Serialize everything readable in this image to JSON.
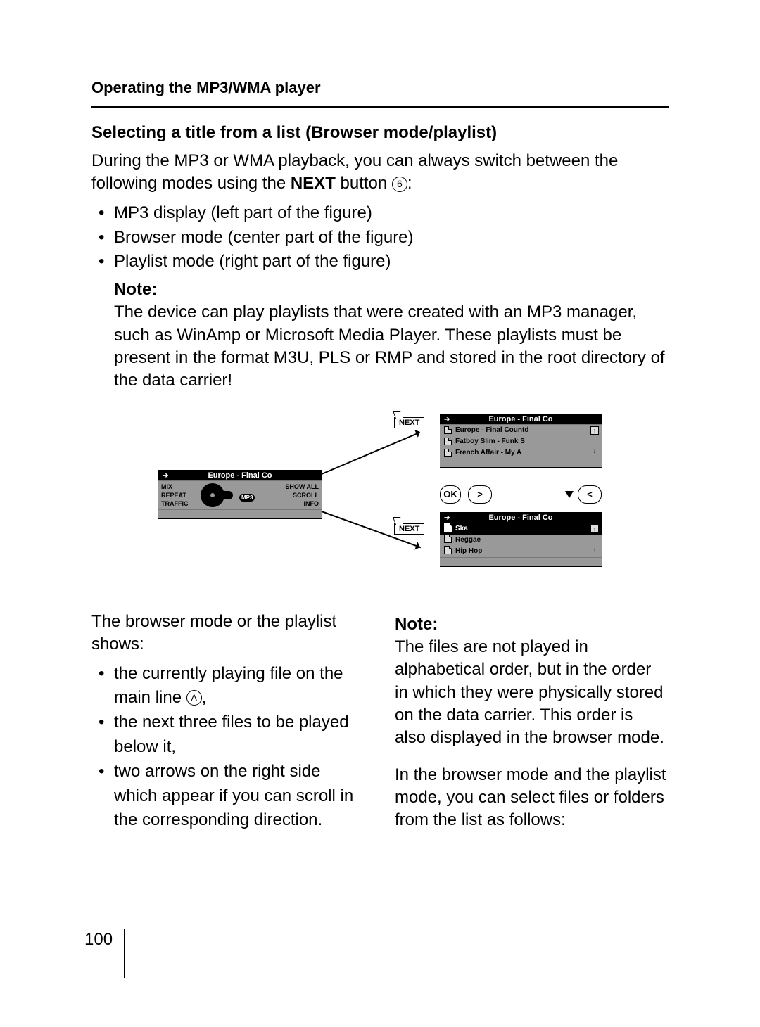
{
  "header": {
    "section": "Operating the MP3/WMA player"
  },
  "heading": "Selecting a title from a list (Browser mode/playlist)",
  "intro": {
    "pre": "During the MP3 or WMA playback, you can always switch between the following modes using the ",
    "next": "NEXT",
    "post": " button ",
    "ref": "6",
    "tail": ":"
  },
  "modes": [
    "MP3 display (left part of the figure)",
    "Browser mode (center part of the figure)",
    "Playlist mode (right part of the figure)"
  ],
  "note1": {
    "label": "Note:",
    "text": "The device can play playlists that were created with an MP3 manager, such as WinAmp or Microsoft Media Player. These playlists must be present in the format M3U, PLS or RMP and stored in the root directory of the data carrier!"
  },
  "figure": {
    "next_label": "NEXT",
    "left_title": "Europe - Final Co",
    "left_l1": "MIX",
    "left_l2": "REPEAT",
    "left_l3": "TRAFFIC",
    "left_r1": "SHOW ALL",
    "left_r2": "SCROLL",
    "left_r3": "INFO",
    "left_tag": "MP3",
    "r1_title": "Europe - Final Co",
    "r1_items": [
      "Europe - Final Countd",
      "Fatboy Slim - Funk S",
      "French Affair - My A"
    ],
    "r2_title": "Europe - Final Co",
    "r2_items": [
      "Ska",
      "Reggae",
      "Hip Hop"
    ],
    "btn_ok": "OK",
    "btn_gt": ">",
    "btn_lt": "<"
  },
  "left_col": {
    "intro": "The browser mode or the playlist shows:",
    "items_pre": "the currently playing file on the main line ",
    "items_ref": "A",
    "items_post": ",",
    "item2": "the next three files to be played below it,",
    "item3": "two arrows on the right side which appear if you can scroll in the corresponding direction."
  },
  "right_col": {
    "note_label": "Note:",
    "note_text": "The files are not played in alphabetical order, but in the order in which they were physically stored on the data carrier. This order is also displayed in the browser mode.",
    "after": "In the browser mode and the playlist mode, you can select files or folders from the list as follows:"
  },
  "page_number": "100"
}
